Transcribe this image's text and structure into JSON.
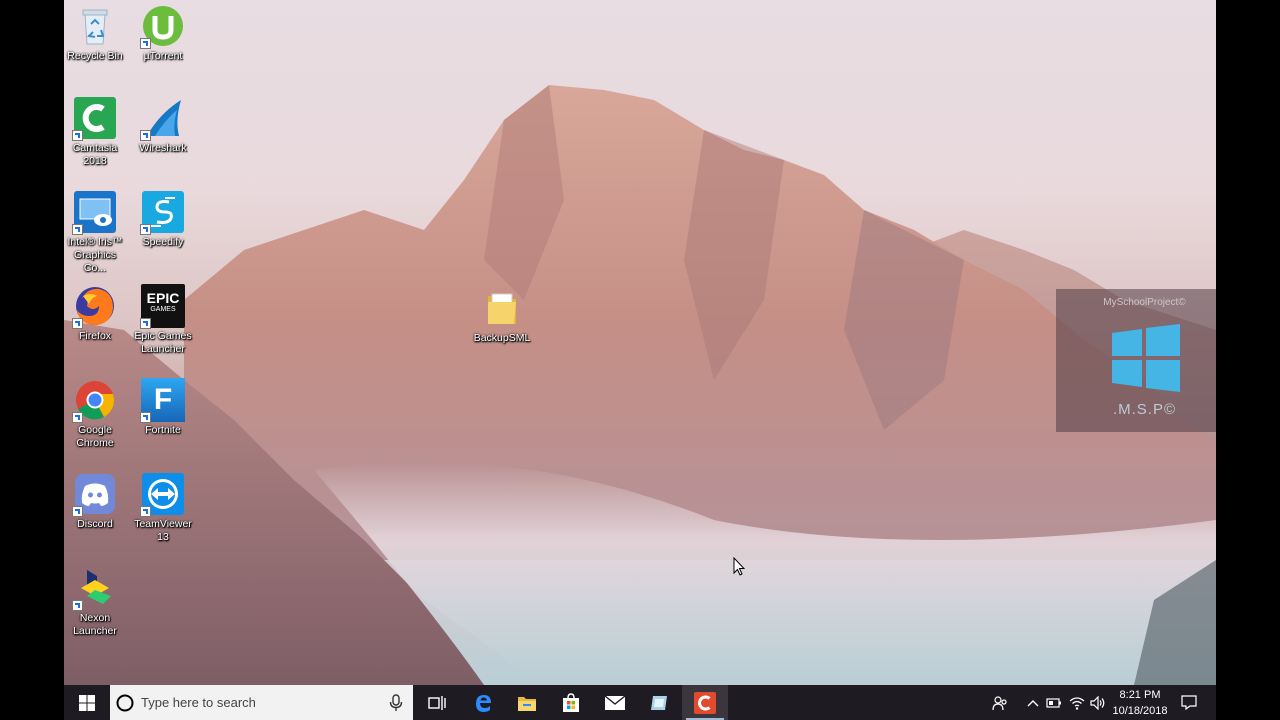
{
  "desktop": {
    "icons": [
      {
        "label": "Recycle Bin",
        "icon": "recycle-bin-icon"
      },
      {
        "label": "µTorrent",
        "icon": "utorrent-icon"
      },
      {
        "label": "Camtasia 2018",
        "icon": "camtasia-icon"
      },
      {
        "label": "Wireshark",
        "icon": "wireshark-icon"
      },
      {
        "label": "Intel® Iris™ Graphics Co...",
        "icon": "intel-graphics-icon"
      },
      {
        "label": "Speedify",
        "icon": "speedify-icon"
      },
      {
        "label": "Firefox",
        "icon": "firefox-icon"
      },
      {
        "label": "Epic Games Launcher",
        "icon": "epic-games-icon"
      },
      {
        "label": "Google Chrome",
        "icon": "chrome-icon"
      },
      {
        "label": "Fortnite",
        "icon": "fortnite-icon"
      },
      {
        "label": "Discord",
        "icon": "discord-icon"
      },
      {
        "label": "TeamViewer 13",
        "icon": "teamviewer-icon"
      },
      {
        "label": "Nexon Launcher",
        "icon": "nexon-launcher-icon"
      },
      {
        "label": "BackupSML",
        "icon": "folder-icon"
      }
    ],
    "epic_logo_line1": "EPIC",
    "epic_logo_line2": "GAMES",
    "fortnite_logo": "F"
  },
  "watermark": {
    "top_text": "MySchoolProject©",
    "bottom_text": ".M.S.P©"
  },
  "taskbar": {
    "search_placeholder": "Type here to search",
    "pinned": [
      {
        "icon": "task-view-icon"
      },
      {
        "icon": "edge-icon"
      },
      {
        "icon": "file-explorer-icon"
      },
      {
        "icon": "microsoft-store-icon"
      },
      {
        "icon": "mail-icon"
      },
      {
        "icon": "app-icon"
      },
      {
        "icon": "camtasia-icon",
        "active": true
      }
    ],
    "clock": {
      "time": "8:21 PM",
      "date": "10/18/2018"
    }
  }
}
